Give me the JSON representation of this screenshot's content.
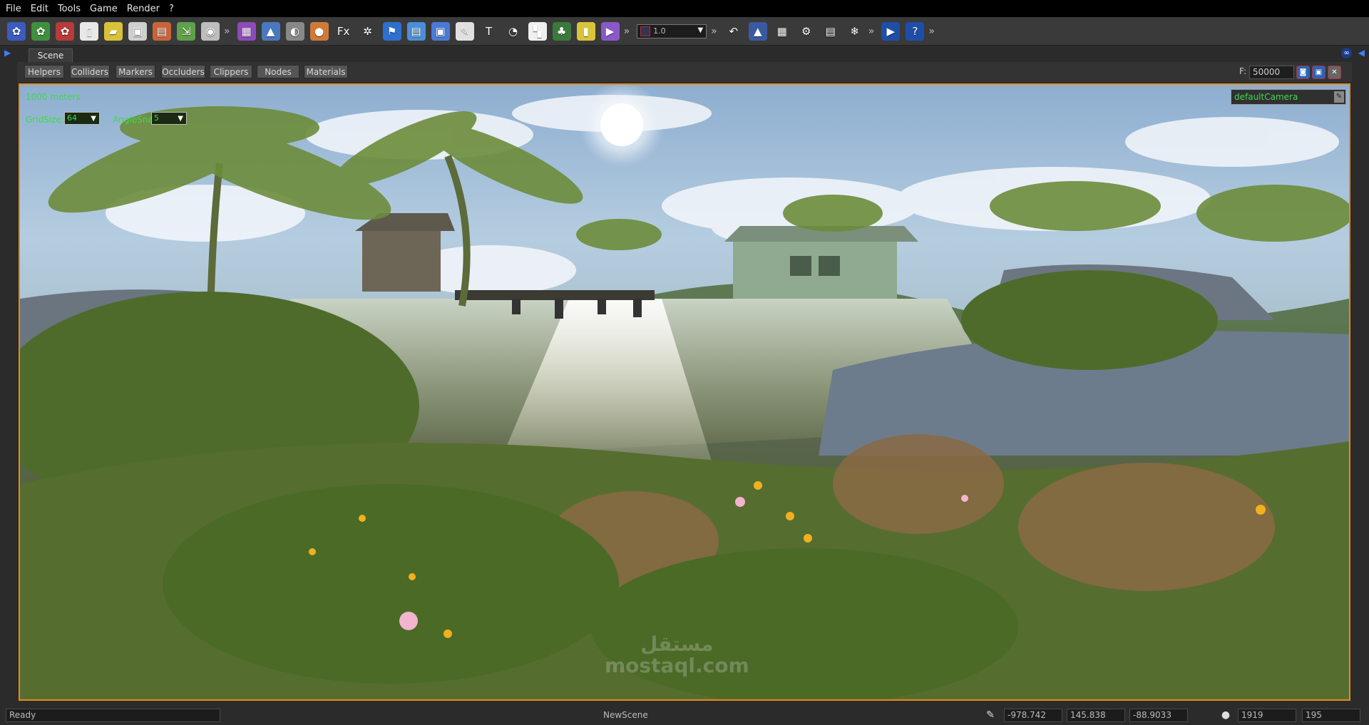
{
  "menu": [
    "File",
    "Edit",
    "Tools",
    "Game",
    "Render",
    "?"
  ],
  "toolbar": {
    "buttons_a": [
      {
        "name": "new-project-icon",
        "glyph": "✿",
        "color": "#3b5bbf"
      },
      {
        "name": "open-project-icon",
        "glyph": "✿",
        "color": "#3f8f3f"
      },
      {
        "name": "project-settings-icon",
        "glyph": "✿",
        "color": "#b83a3a"
      },
      {
        "name": "new-scene-icon",
        "glyph": "▯",
        "color": "#e8e8e8"
      },
      {
        "name": "open-scene-icon",
        "glyph": "▰",
        "color": "#d8c23a"
      },
      {
        "name": "save-icon",
        "glyph": "▣",
        "color": "#cfcfcf"
      },
      {
        "name": "save-as-icon",
        "glyph": "▤",
        "color": "#c9643a"
      },
      {
        "name": "import-icon",
        "glyph": "⇲",
        "color": "#5fa04a"
      },
      {
        "name": "disc-icon",
        "glyph": "◉",
        "color": "#bdbdbd"
      }
    ],
    "buttons_b": [
      {
        "name": "cube-icon",
        "glyph": "▦",
        "color": "#8e4ab8"
      },
      {
        "name": "terrain-icon",
        "glyph": "▲",
        "color": "#4a78c0"
      },
      {
        "name": "mouse-icon",
        "glyph": "◐",
        "color": "#888"
      },
      {
        "name": "sphere-icon",
        "glyph": "●",
        "color": "#d07a3a"
      },
      {
        "name": "fx-icon",
        "glyph": "Fx",
        "color": "transparent"
      },
      {
        "name": "gear-wheel-icon",
        "glyph": "✲",
        "color": "transparent"
      },
      {
        "name": "flag-icon",
        "glyph": "⚑",
        "color": "#2e6fd0"
      },
      {
        "name": "document-icon",
        "glyph": "▤",
        "color": "#4a8ed8"
      },
      {
        "name": "group-icon",
        "glyph": "▣",
        "color": "#4a7ad8"
      },
      {
        "name": "notepad-icon",
        "glyph": "✎",
        "color": "#e0e0e0"
      },
      {
        "name": "text-icon",
        "glyph": "T",
        "color": "transparent"
      },
      {
        "name": "sound-icon",
        "glyph": "◔",
        "color": "transparent"
      },
      {
        "name": "checker-icon",
        "glyph": "▚",
        "color": "#f0f0f0"
      },
      {
        "name": "tree-icon",
        "glyph": "♣",
        "color": "#3a7a3a"
      },
      {
        "name": "note-icon",
        "glyph": "▮",
        "color": "#d8c43a"
      },
      {
        "name": "video-icon",
        "glyph": "▶",
        "color": "#8a58c8"
      }
    ],
    "version_value": "1.0",
    "buttons_c": [
      {
        "name": "undo-icon",
        "glyph": "↶",
        "color": "transparent"
      },
      {
        "name": "terrain-tool-icon",
        "glyph": "▲",
        "color": "#3a5aa0"
      },
      {
        "name": "grid-icon",
        "glyph": "▦",
        "color": "transparent"
      },
      {
        "name": "settings-icon",
        "glyph": "⚙",
        "color": "transparent"
      },
      {
        "name": "keyboard-icon",
        "glyph": "▤",
        "color": "transparent"
      }
    ],
    "buttons_d": [
      {
        "name": "snow-icon",
        "glyph": "❄",
        "color": "transparent"
      }
    ],
    "buttons_e": [
      {
        "name": "play-icon",
        "glyph": "▶",
        "color": "#1e4ea8"
      },
      {
        "name": "help-icon",
        "glyph": "?",
        "color": "#1e4ea8"
      }
    ],
    "overflow_glyph": "»"
  },
  "tabs": {
    "scene_tab": "Scene"
  },
  "filters": {
    "buttons": [
      "Helpers",
      "Colliders",
      "Markers",
      "Occluders",
      "Clippers",
      "Nodes",
      "Materials"
    ],
    "far_label": "F:",
    "far_value": "50000"
  },
  "viewport": {
    "scale_label": "1000 meters",
    "grid_size_label": "GridSize:",
    "grid_size_value": "64",
    "angle_snap_label": "AngleSnap",
    "angle_snap_value": "5",
    "camera_name": "defaultCamera",
    "accent_color": "#e58a1a",
    "overlay_color": "#3ed84d"
  },
  "watermark": {
    "line1": "مستقل",
    "line2": "mostaql.com"
  },
  "status": {
    "ready": "Ready",
    "scene_name": "NewScene",
    "pos_x": "-978.742",
    "pos_y": "145.838",
    "pos_z": "-88.9033",
    "res_width": "1919",
    "res_height": "195"
  }
}
